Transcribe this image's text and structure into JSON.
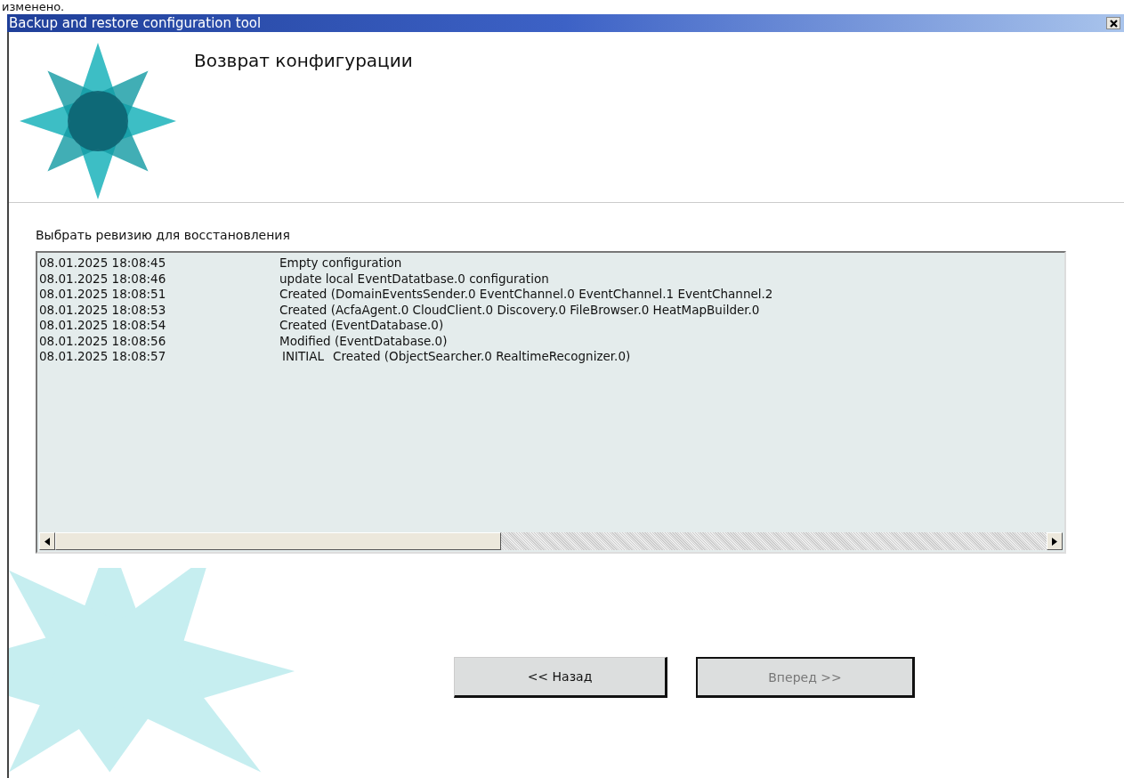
{
  "top_note": "изменено.",
  "window": {
    "title": "Backup and restore configuration tool"
  },
  "header": {
    "title": "Возврат конфигурации"
  },
  "revisions": {
    "label": "Выбрать ревизию для восстановления",
    "rows": [
      {
        "time": "08.01.2025 18:08:45",
        "description": "Empty configuration"
      },
      {
        "time": "08.01.2025 18:08:46",
        "description": "update local EventDatatbase.0 configuration"
      },
      {
        "time": "08.01.2025 18:08:51",
        "description": "Created (DomainEventsSender.0 EventChannel.0 EventChannel.1 EventChannel.2"
      },
      {
        "time": "08.01.2025 18:08:53",
        "description": "Created (AcfaAgent.0 CloudClient.0 Discovery.0 FileBrowser.0 HeatMapBuilder.0"
      },
      {
        "time": "08.01.2025 18:08:54",
        "description": "Created (EventDatabase.0)"
      },
      {
        "time": "08.01.2025 18:08:56",
        "description": "Modified (EventDatabase.0)"
      },
      {
        "time": "08.01.2025 18:08:57",
        "tag": "INITIAL",
        "description": "Created (ObjectSearcher.0 RealtimeRecognizer.0)"
      }
    ]
  },
  "buttons": [
    {
      "label": "<< Назад",
      "disabled": false
    },
    {
      "label": "Вперед >>",
      "disabled": true
    }
  ]
}
